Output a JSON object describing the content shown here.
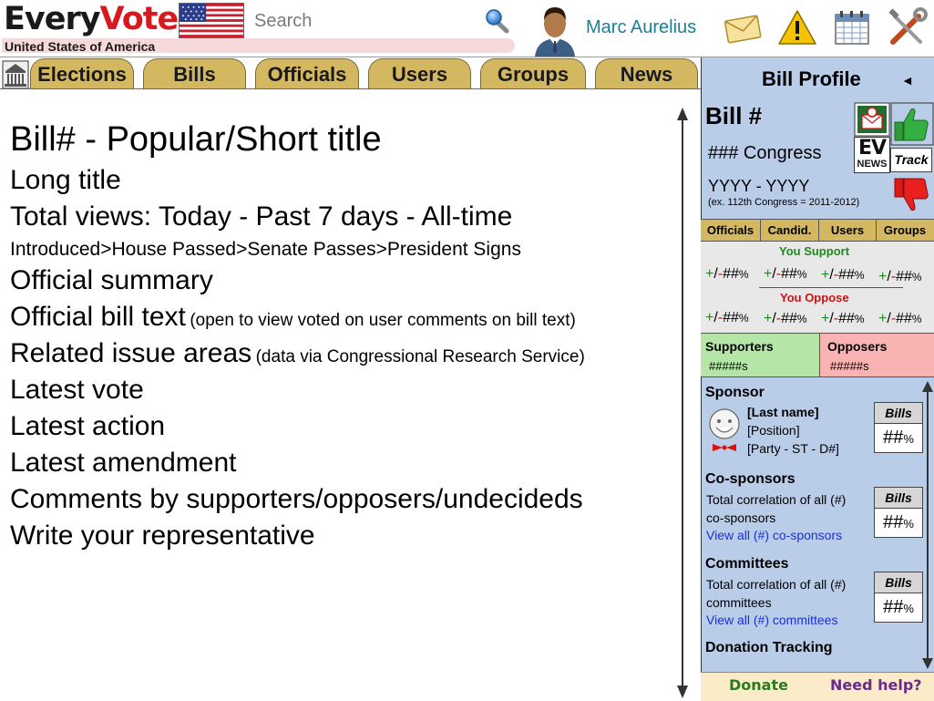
{
  "header": {
    "logo_every": "Every",
    "logo_vote": "Vote",
    "country": "United States of America",
    "search_placeholder": "Search",
    "username": "Marc Aurelius"
  },
  "icons": {
    "flag": "us-flag-icon",
    "search": "magnifier-icon",
    "avatar": "user-avatar",
    "mail": "envelope-icon",
    "alert": "warning-icon",
    "calendar": "calendar-icon",
    "tools": "tools-icon",
    "capitol": "capitol-building-icon"
  },
  "tabs": [
    "Elections",
    "Bills",
    "Officials",
    "Users",
    "Groups",
    "News"
  ],
  "main": {
    "title": "Bill# - Popular/Short title",
    "long_title": "Long title",
    "views": "Total views: Today - Past 7 days - All-time",
    "progress": "Introduced>House Passed>Senate Passes>President Signs",
    "summary": "Official summary",
    "bill_text": "Official bill text",
    "bill_text_note": "(open to view voted on user comments on bill text)",
    "issues": "Related issue areas",
    "issues_note": "(data via Congressional Research Service)",
    "latest_vote": "Latest vote",
    "latest_action": "Latest action",
    "latest_amendment": "Latest amendment",
    "comments": "Comments by supporters/opposers/undecideds",
    "write_rep": "Write your representative"
  },
  "panel": {
    "title": "Bill Profile",
    "collapse": "◄",
    "bill_num": "Bill #",
    "congress": "### Congress",
    "years": "YYYY - YYYY",
    "years_note": "(ex. 112th Congress = 2011-2012)",
    "track": "Track",
    "ev_news": {
      "ev": "EV",
      "news": "NEWS"
    },
    "stat_tabs": [
      "Officials",
      "Candid.",
      "Users",
      "Groups"
    ],
    "you_support": "You Support",
    "you_oppose": "You Oppose",
    "pct_plus": "+",
    "pct_slash": "/",
    "pct_minus": "-",
    "pct_value": "##",
    "pct_unit": "%",
    "supporters_label": "Supporters",
    "supporters_count": "#####s",
    "opposers_label": "Opposers",
    "opposers_count": "#####s",
    "sponsor": {
      "title": "Sponsor",
      "last_name": "[Last name]",
      "position": "[Position]",
      "party": "[Party - ST - D#]"
    },
    "bills_label": "Bills",
    "bills_value": "##",
    "cosponsors": {
      "title": "Co-sponsors",
      "line1": "Total correlation of all (#)",
      "line2": "co-sponsors",
      "link": "View all (#) co-sponsors"
    },
    "committees": {
      "title": "Committees",
      "line1": "Total correlation of all (#)",
      "line2": "committees",
      "link": "View all (#) committees"
    },
    "donation": "Donation Tracking",
    "donate": "Donate",
    "help": "Need help?"
  }
}
